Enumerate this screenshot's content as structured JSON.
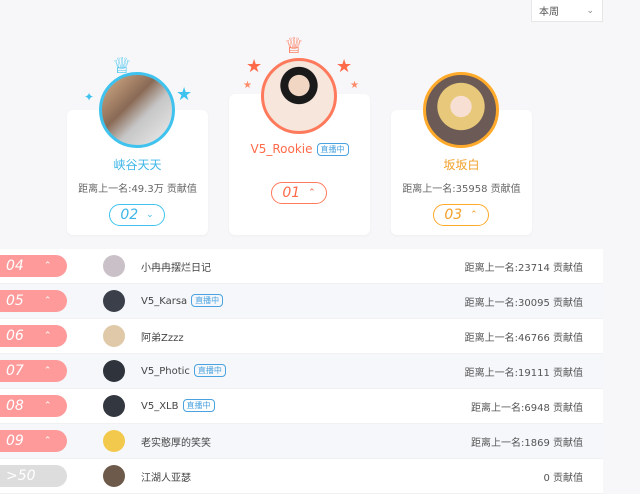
{
  "period_select": {
    "value": "本周"
  },
  "top3": {
    "second": {
      "name": "峡谷天天",
      "dist": "距离上一名:49.3万 贡献值",
      "rank": "02"
    },
    "first": {
      "name": "V5_Rookie",
      "badge": "直播中",
      "rank": "01"
    },
    "third": {
      "name": "坂坂白",
      "dist": "距离上一名:35958 贡献值",
      "rank": "03"
    }
  },
  "rows": [
    {
      "rank": "04",
      "name": "小冉冉摆烂日记",
      "badge": "",
      "dist": "距离上一名:23714 贡献值",
      "avatar_color": "#c9c0c8"
    },
    {
      "rank": "05",
      "name": "V5_Karsa",
      "badge": "直播中",
      "dist": "距离上一名:30095 贡献值",
      "avatar_color": "#3a3f4a"
    },
    {
      "rank": "06",
      "name": "阿弟Zzzz",
      "badge": "",
      "dist": "距离上一名:46766 贡献值",
      "avatar_color": "#e0c9a8"
    },
    {
      "rank": "07",
      "name": "V5_Photic",
      "badge": "直播中",
      "dist": "距离上一名:19111 贡献值",
      "avatar_color": "#2f333b"
    },
    {
      "rank": "08",
      "name": "V5_XLB",
      "badge": "直播中",
      "dist": "距离上一名:6948 贡献值",
      "avatar_color": "#33373f"
    },
    {
      "rank": "09",
      "name": "老实憨厚的笑笑",
      "badge": "",
      "dist": "距离上一名:1869 贡献值",
      "avatar_color": "#f2c94c"
    },
    {
      "rank": ">50",
      "name": "江湖人亚瑟",
      "badge": "",
      "dist": "0 贡献值",
      "avatar_color": "#6d5a4a"
    }
  ]
}
